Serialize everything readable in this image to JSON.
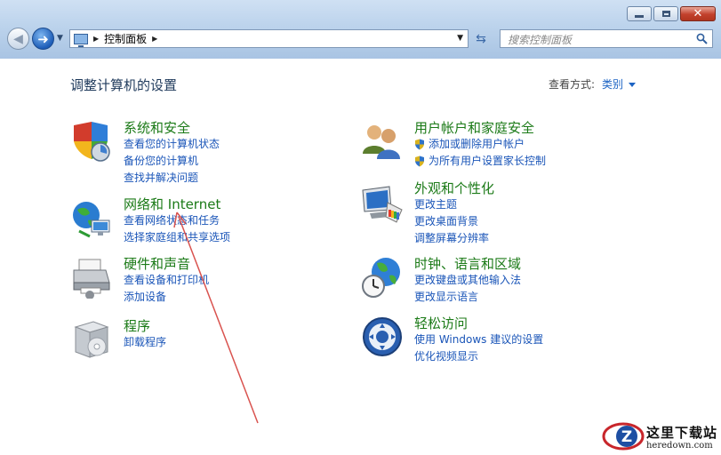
{
  "window": {
    "minimize_icon": "minimize-icon",
    "maximize_icon": "maximize-icon",
    "close_icon": "close-icon"
  },
  "nav": {
    "address_crumb": "控制面板",
    "search_placeholder": "搜索控制面板"
  },
  "main": {
    "page_title": "调整计算机的设置",
    "view_by_label": "查看方式:",
    "view_by_value": "类别"
  },
  "categories": {
    "system": {
      "title": "系统和安全",
      "links": [
        "查看您的计算机状态",
        "备份您的计算机",
        "查找并解决问题"
      ]
    },
    "network": {
      "title": "网络和 Internet",
      "links": [
        "查看网络状态和任务",
        "选择家庭组和共享选项"
      ]
    },
    "hardware": {
      "title": "硬件和声音",
      "links": [
        "查看设备和打印机",
        "添加设备"
      ]
    },
    "programs": {
      "title": "程序",
      "links": [
        "卸载程序"
      ]
    },
    "users": {
      "title": "用户帐户和家庭安全",
      "links": [
        "添加或删除用户帐户",
        "为所有用户设置家长控制"
      ]
    },
    "appearance": {
      "title": "外观和个性化",
      "links": [
        "更改主题",
        "更改桌面背景",
        "调整屏幕分辨率"
      ]
    },
    "clock": {
      "title": "时钟、语言和区域",
      "links": [
        "更改键盘或其他输入法",
        "更改显示语言"
      ]
    },
    "ease": {
      "title": "轻松访问",
      "links": [
        "使用 Windows 建议的设置",
        "优化视频显示"
      ]
    }
  },
  "watermark": {
    "cn": "这里下载站",
    "en": "heredown.com"
  },
  "colors": {
    "category_title": "#1b7a17",
    "link": "#1a55b8",
    "annotation_arrow": "#d9534f"
  }
}
